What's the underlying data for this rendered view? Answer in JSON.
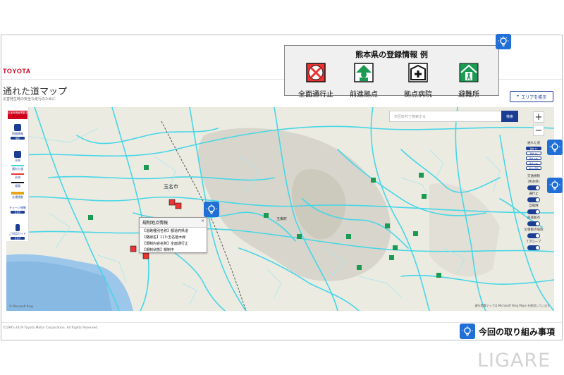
{
  "header": {
    "logo": "TOYOTA",
    "title": "通れた道マップ",
    "subtitle": "災害発生時の安全な走行のために",
    "area_button": "エリアを揃示"
  },
  "legend": {
    "title": "熊本県の登録情報 例",
    "items": [
      {
        "label": "全面通行止",
        "icon": "road-closed-icon"
      },
      {
        "label": "前進拠点",
        "icon": "forward-base-icon"
      },
      {
        "label": "拠点病院",
        "icon": "hospital-icon"
      },
      {
        "label": "避難所",
        "icon": "evacuation-shelter-icon"
      }
    ]
  },
  "search": {
    "placeholder": "市区町村で検索する",
    "button": "検索"
  },
  "zoom": {
    "in": "+",
    "out": "−"
  },
  "left_panel": {
    "red_button": "災害時情報掲載中",
    "items": [
      {
        "label": "地図情報",
        "sub": "設定"
      },
      {
        "label": "凡例",
        "sub": ""
      },
      {
        "label": "通れた道",
        "sub": ""
      },
      {
        "label": "渋滞",
        "sub": ""
      },
      {
        "label": "道路",
        "sub": ""
      },
      {
        "label": "交通規制",
        "sub": ""
      },
      {
        "label": "チェーン規制",
        "sub": "全表示"
      },
      {
        "label": "ご利用ガイド",
        "sub": "全表示"
      }
    ]
  },
  "right_panel": {
    "tooreta": "通れた道",
    "chips": [
      "過去 1h",
      "過去 3h",
      "過去 24h",
      "過去 72h",
      "過去1週間"
    ],
    "kisei": "交通規制",
    "kisei_sub": "(熊本県)",
    "toggles": [
      "通行止",
      "自衛隊",
      "前進拠点",
      "災害拠点病院",
      "Tプローブ"
    ]
  },
  "popup": {
    "title": "規制地点情報",
    "rows": [
      "【道路種別名称】都道府県道",
      "【路線名】113:玉名植木線",
      "【規制内容名称】全面通行止",
      "【規制状態】規制中"
    ],
    "close": "×"
  },
  "map_labels": {
    "city": "玉名市",
    "place2": "玉東町",
    "credit": "© Microsoft Bing",
    "scale": "通行実績マップは Microsoft Bing Maps を使用しています"
  },
  "footer": {
    "copyright": "©1995-2019 Toyota Motor Corporation. All Rights Reserved.",
    "torikumi": "今回の取り組み事項"
  },
  "watermark": "LIGARE",
  "colors": {
    "brand_red": "#d0021b",
    "navy": "#1b3d94",
    "road_cyan": "#46d6e6",
    "bulb_blue": "#1f6fd6"
  }
}
